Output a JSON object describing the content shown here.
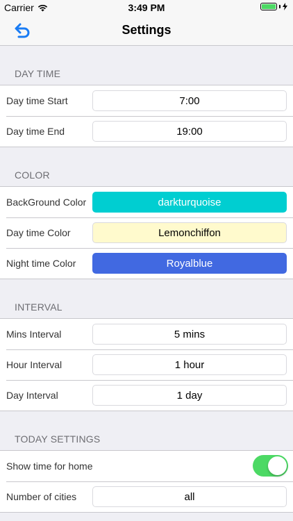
{
  "status": {
    "carrier": "Carrier",
    "time": "3:49 PM"
  },
  "nav": {
    "title": "Settings",
    "back_icon": "undo-arrow-icon"
  },
  "sections": {
    "daytime": {
      "header": "DAY TIME",
      "start_label": "Day time Start",
      "start_value": "7:00",
      "end_label": "Day time End",
      "end_value": "19:00"
    },
    "color": {
      "header": "COLOR",
      "bg_label": "BackGround Color",
      "bg_value": "darkturquoise",
      "bg_color": "#00ced1",
      "day_label": "Day time Color",
      "day_value": "Lemonchiffon",
      "day_color": "#fffacd",
      "night_label": "Night time Color",
      "night_value": "Royalblue",
      "night_color": "#4169e1"
    },
    "interval": {
      "header": "INTERVAL",
      "mins_label": "Mins Interval",
      "mins_value": "5 mins",
      "hour_label": "Hour Interval",
      "hour_value": "1 hour",
      "day_label": "Day Interval",
      "day_value": "1 day"
    },
    "today": {
      "header": "TODAY SETTINGS",
      "home_label": "Show time for home",
      "home_on": true,
      "cities_label": "Number of cities",
      "cities_value": "all"
    }
  },
  "colors": {
    "accent": "#1a7cf4",
    "toggle_on": "#4cd964"
  }
}
